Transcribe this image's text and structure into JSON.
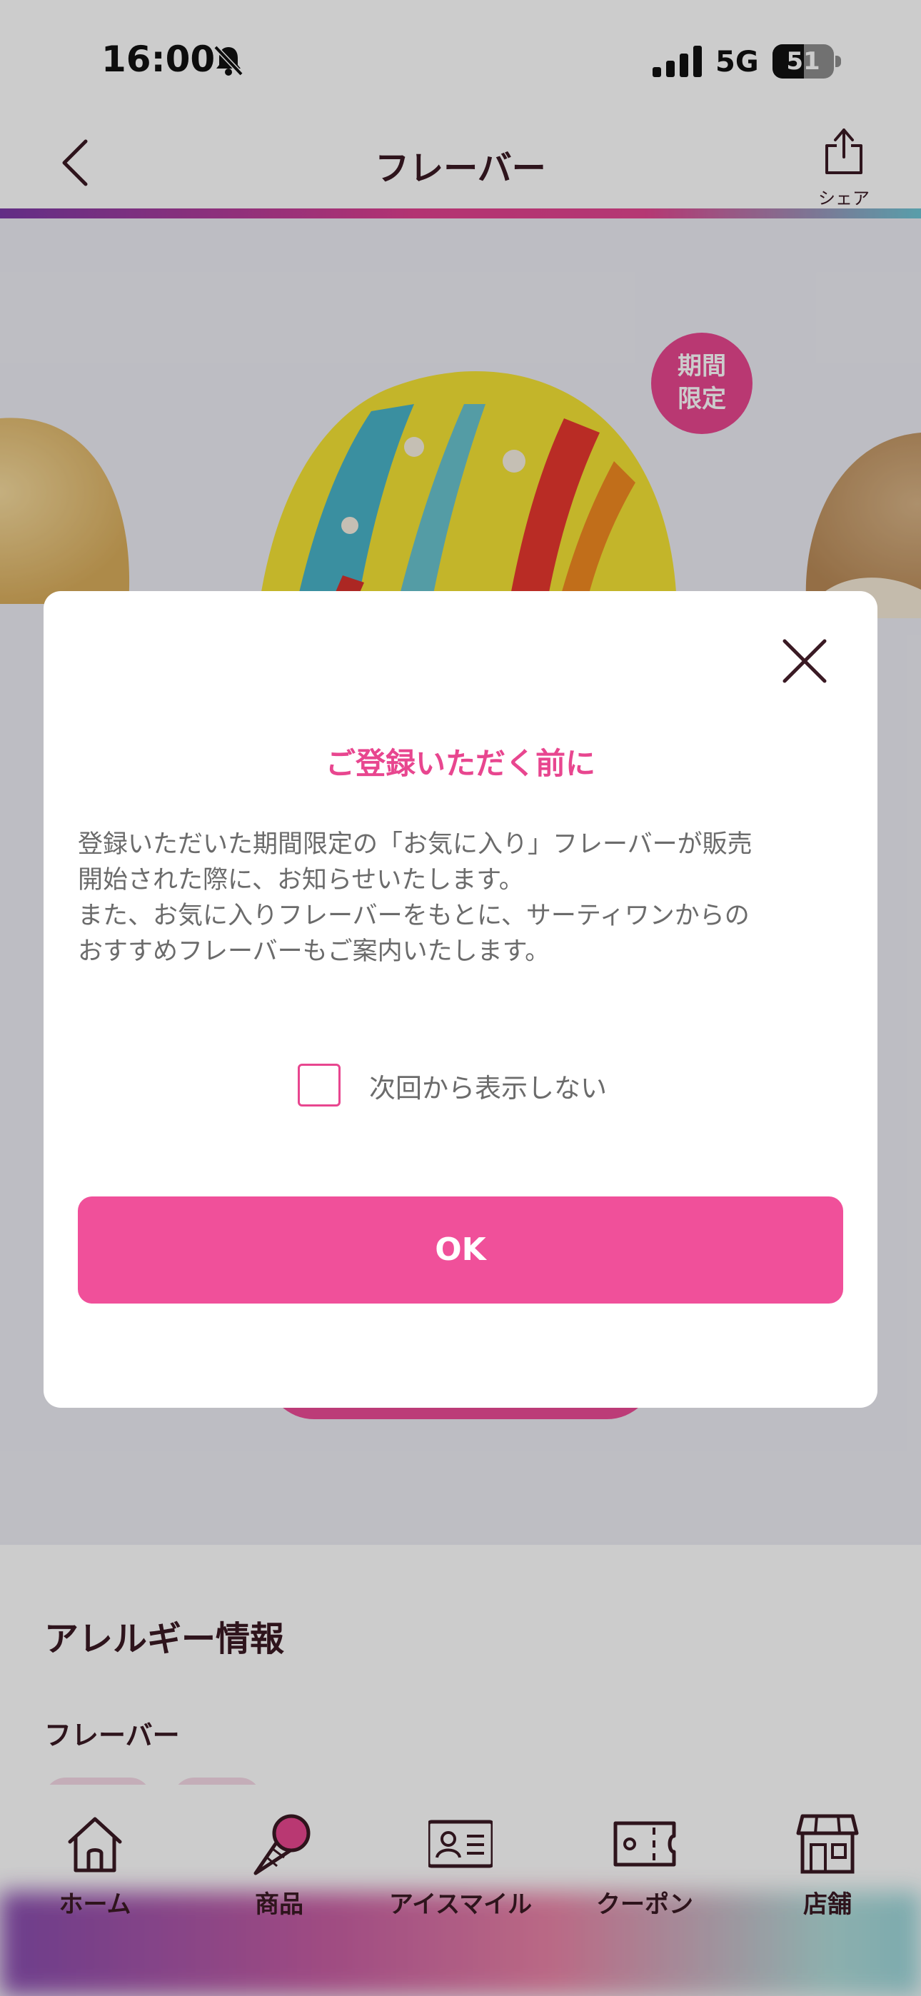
{
  "status_bar": {
    "time": "16:00",
    "network": "5G",
    "battery_level": "51",
    "battery_fraction": 0.51
  },
  "nav": {
    "title": "フレーバー",
    "share_label": "シェア"
  },
  "hero": {
    "badge_line1": "期間",
    "badge_line2": "限定"
  },
  "allergy": {
    "title": "アレルギー情報",
    "subtitle": "フレーバー"
  },
  "tabs": [
    {
      "label": "ホーム",
      "icon": "home-icon"
    },
    {
      "label": "商品",
      "icon": "ice-cream-cone-icon"
    },
    {
      "label": "アイスマイル",
      "icon": "member-card-icon"
    },
    {
      "label": "クーポン",
      "icon": "coupon-ticket-icon"
    },
    {
      "label": "店舗",
      "icon": "store-icon"
    }
  ],
  "modal": {
    "title": "ご登録いただく前に",
    "body": "登録いただいた期間限定の「お気に入り」フレーバーが販売\n開始された際に、お知らせいたします。\nまた、お気に入りフレーバーをもとに、サーティワンからの\nおすすめフレーバーもご案内いたします。",
    "checkbox_label": "次回から表示しない",
    "checkbox_checked": false,
    "ok_label": "OK"
  },
  "colors": {
    "accent_pink": "#e8468f",
    "button_pink": "#f0509a",
    "text_dark": "#3a1a24"
  }
}
